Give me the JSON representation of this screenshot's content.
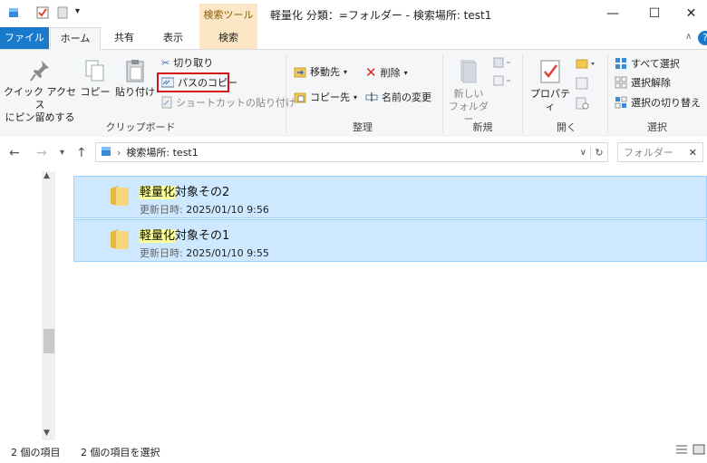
{
  "window": {
    "title": "軽量化 分類：=フォルダー - 検索場所: test1",
    "context_tab_group": "検索ツール",
    "controls": [
      "—",
      "☐",
      "✕"
    ]
  },
  "tabs": [
    {
      "label": "ファイル"
    },
    {
      "label": "ホーム"
    },
    {
      "label": "共有"
    },
    {
      "label": "表示"
    },
    {
      "label": "検索"
    }
  ],
  "ribbon": {
    "clipboard": {
      "label": "クリップボード",
      "pin_line1": "クイック アクセス",
      "pin_line2": "にピン留めする",
      "copy": "コピー",
      "paste": "貼り付け",
      "cut": "切り取り",
      "copy_path": "パスのコピー",
      "paste_shortcut": "ショートカットの貼り付け"
    },
    "organize": {
      "label": "整理",
      "move_to": "移動先",
      "copy_to": "コピー先",
      "delete": "削除",
      "rename": "名前の変更"
    },
    "new": {
      "label": "新規",
      "new_folder_line1": "新しい",
      "new_folder_line2": "フォルダー"
    },
    "open": {
      "label": "開く",
      "properties": "プロパティ"
    },
    "select": {
      "label": "選択",
      "select_all": "すべて選択",
      "select_none": "選択解除",
      "invert": "選択の切り替え"
    }
  },
  "address": {
    "path": "検索場所: test1",
    "search_placeholder": "フォルダー"
  },
  "items": [
    {
      "name_hl": "軽量化",
      "name_rest": "対象その2",
      "meta_label": "更新日時:",
      "meta_value": "2025/01/10 9:56"
    },
    {
      "name_hl": "軽量化",
      "name_rest": "対象その1",
      "meta_label": "更新日時:",
      "meta_value": "2025/01/10 9:55"
    }
  ],
  "status": {
    "count": "2 個の項目",
    "selected": "2 個の項目を選択"
  },
  "colors": {
    "file_tab": "#1979ca",
    "selection": "#cde8ff",
    "highlight_box": "#d5141a",
    "match": "#ffff99"
  }
}
